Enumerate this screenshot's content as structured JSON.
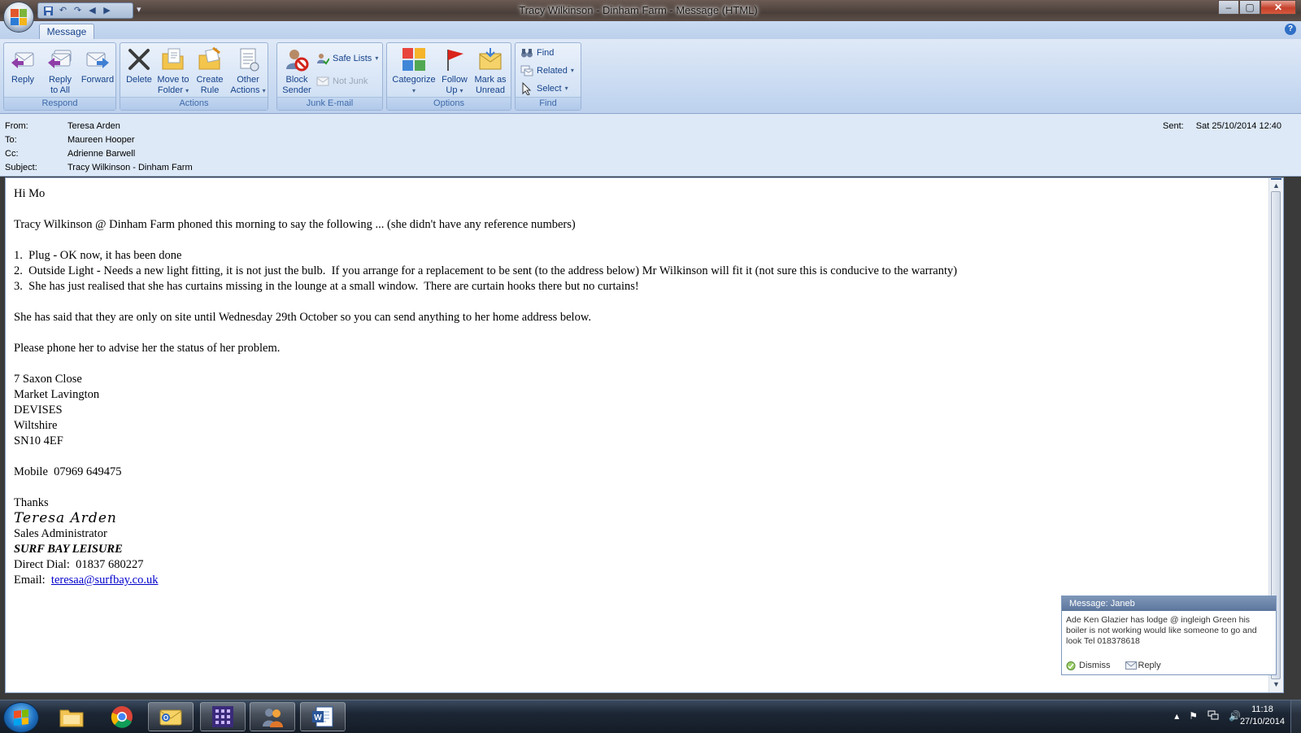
{
  "window": {
    "title": "Tracy Wilkinson - Dinham Farm  - Message (HTML)",
    "qat_more": "▾",
    "controls": {
      "minimize": "–",
      "maximize": "▢",
      "close": "✕"
    },
    "help": "?"
  },
  "ribbon": {
    "tab": "Message",
    "groups": {
      "respond": {
        "label": "Respond",
        "reply": "Reply",
        "reply_all_1": "Reply",
        "reply_all_2": "to All",
        "forward": "Forward"
      },
      "actions": {
        "label": "Actions",
        "delete": "Delete",
        "move_1": "Move to",
        "move_2": "Folder",
        "create_rule_1": "Create",
        "create_rule_2": "Rule",
        "other_1": "Other",
        "other_2": "Actions"
      },
      "junk": {
        "label": "Junk E-mail",
        "block_1": "Block",
        "block_2": "Sender",
        "safe_lists": "Safe Lists",
        "not_junk": "Not Junk"
      },
      "options": {
        "label": "Options",
        "categorize": "Categorize",
        "follow_1": "Follow",
        "follow_2": "Up",
        "mark_1": "Mark as",
        "mark_2": "Unread"
      },
      "find": {
        "label": "Find",
        "find": "Find",
        "related": "Related",
        "select": "Select"
      }
    }
  },
  "header": {
    "from_label": "From:",
    "from": "Teresa Arden",
    "to_label": "To:",
    "to": "Maureen Hooper",
    "cc_label": "Cc:",
    "cc": "Adrienne Barwell",
    "subject_label": "Subject:",
    "subject": "Tracy Wilkinson - Dinham Farm",
    "sent_label": "Sent:",
    "sent": "Sat 25/10/2014 12:40"
  },
  "message": {
    "greeting": "Hi Mo",
    "intro": "Tracy Wilkinson @ Dinham Farm phoned this morning to say the following ... (she didn't have any reference numbers)",
    "items": [
      "1.  Plug - OK now, it has been done",
      "2.  Outside Light - Needs a new light fitting, it is not just the bulb.  If you arrange for a replacement to be sent (to the address below) Mr Wilkinson will fit it (not sure this is conducive to the warranty)",
      "3.  She has just realised that she has curtains missing in the lounge at a small window.  There are curtain hooks there but no curtains!"
    ],
    "onsite": "She has said that they are only on site until Wednesday 29th October so you can send anything to her home address below.",
    "phone_request": "Please phone her to advise her the status of her problem.",
    "address": [
      "7 Saxon Close",
      "Market Lavington",
      "DEVISES",
      "Wiltshire",
      "SN10 4EF"
    ],
    "mobile": "Mobile  07969 649475",
    "thanks": "Thanks",
    "signature_name": "Teresa Arden",
    "role": "Sales Administrator",
    "company": "SURF BAY LEISURE",
    "direct_dial": "Direct Dial:  01837 680227",
    "email_label": "Email:  ",
    "email": "teresaa@surfbay.co.uk"
  },
  "alert": {
    "title": "Message: Janeb",
    "text": "Ade Ken Glazier has lodge @ ingleigh Green his boiler is not working would like  someone to go and look Tel 018378618",
    "dismiss": "Dismiss",
    "reply": "Reply"
  },
  "taskbar": {
    "time": "11:18",
    "date": "27/10/2014",
    "tray": {
      "up": "▴",
      "flag": "⚑",
      "volume": "🔊"
    }
  }
}
